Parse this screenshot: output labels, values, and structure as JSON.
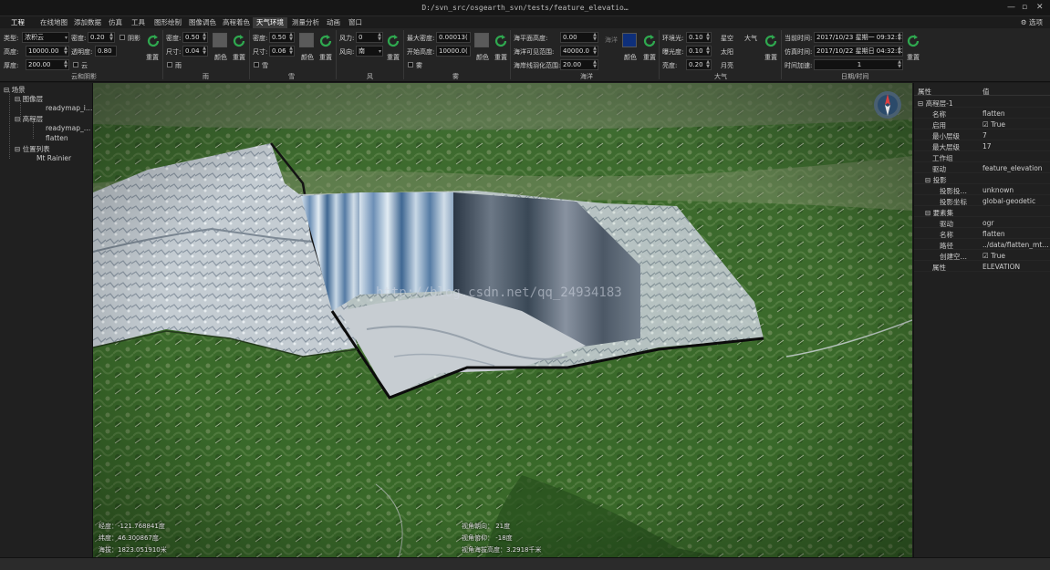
{
  "window": {
    "title": "D:/svn_src/osgearth_svn/tests/feature_elevatio…",
    "options": "选项"
  },
  "menu": [
    "工程",
    "在线地图",
    "添加数据",
    "仿真",
    "工具",
    "图形绘制",
    "图像调色",
    "高程着色",
    "天气环境",
    "测量分析",
    "动画",
    "窗口"
  ],
  "ribbon": {
    "cloud": {
      "type_label": "类型:",
      "type_value": "浓积云",
      "density_label": "密度:",
      "density_value": "0.20",
      "shadow_label": "阴影",
      "height_label": "高度:",
      "height_value": "10000.00",
      "alpha_label": "透明度:",
      "alpha_value": "0.80",
      "thickness_label": "厚度:",
      "thickness_value": "200.00",
      "cloud_check_label": "云",
      "reset_label": "重置",
      "group_label": "云和阴影"
    },
    "rain": {
      "density_label": "密度:",
      "density_value": "0.50",
      "size_label": "尺寸:",
      "size_value": "0.04",
      "enable_label": "雨",
      "color_label": "颜色",
      "reset_label": "重置",
      "group_label": "雨"
    },
    "snow": {
      "density_label": "密度:",
      "density_value": "0.50",
      "size_label": "尺寸:",
      "size_value": "0.06",
      "enable_label": "雪",
      "color_label": "颜色",
      "reset_label": "重置",
      "group_label": "雪"
    },
    "wind": {
      "force_label": "风力:",
      "force_value": "0",
      "dir_label": "风向:",
      "dir_value": "南",
      "reset_label": "重置",
      "group_label": "风"
    },
    "fog": {
      "maxdens_label": "最大密度:",
      "maxdens_value": "0.00013(",
      "start_label": "开始高度:",
      "start_value": "10000.0(",
      "enable_label": "雾",
      "color_label": "颜色",
      "reset_label": "重置",
      "group_label": "雾"
    },
    "ocean": {
      "sealevel_label": "海平面高度:",
      "sealevel_value": "0.00",
      "visible_label": "海洋可见范围:",
      "visible_value": "40000.0",
      "fade_label": "海岸线羽化范围:",
      "fade_value": "20.00",
      "sea_label": "海洋",
      "color_label": "颜色",
      "reset_label": "重置",
      "group_label": "海洋"
    },
    "atmos": {
      "ambient_label": "环境光:",
      "ambient_value": "0.10",
      "exposure_label": "曝光度:",
      "exposure_value": "0.10",
      "brightness_label": "亮度:",
      "brightness_value": "0.20",
      "stars_label": "星空",
      "sun_label": "太阳",
      "moon_label": "月亮",
      "atmosphere_label": "大气",
      "reset_label": "重置",
      "group_label": "大气"
    },
    "time": {
      "current_label": "当前时间:",
      "current_value": "2017/10/23 星期一 09:32:11",
      "sim_label": "仿真时间:",
      "sim_value": "2017/10/22 星期日 04:32:12",
      "speed_label": "时间加速:",
      "speed_value": "1",
      "reset_label": "重置",
      "group_label": "日期/时间"
    }
  },
  "scene_tree": {
    "root": "场景",
    "image_layer": "图像层",
    "image_item": "readymap_i…",
    "elev_layer": "高程层",
    "elev_item1": "readymap_…",
    "elev_item2": "flatten",
    "pos_list": "位置列表",
    "pos_item": "Mt Rainier"
  },
  "viewport": {
    "lon": "经度：-121.768841度",
    "lat": "纬度：46.300867度",
    "alt": "海拔：1823.051910米",
    "heading": "视角朝向：       21度",
    "pitch": "视角俯仰：       -18度",
    "eye_alt": "视角海拔高度：3.2918千米",
    "watermark": "http://blog.csdn.net/qq_24934183"
  },
  "properties": {
    "col_prop": "属性",
    "col_value": "值",
    "rows": [
      {
        "k": "高程层-1",
        "v": "",
        "indent": 0,
        "exp": true
      },
      {
        "k": "名称",
        "v": "flatten",
        "indent": 2
      },
      {
        "k": "启用",
        "v": "True",
        "indent": 2,
        "check": true
      },
      {
        "k": "最小层级",
        "v": "7",
        "indent": 2
      },
      {
        "k": "最大层级",
        "v": "17",
        "indent": 2
      },
      {
        "k": "工作组",
        "v": "",
        "indent": 2
      },
      {
        "k": "驱动",
        "v": "feature_elevation",
        "indent": 2
      },
      {
        "k": "投影",
        "v": "",
        "indent": 1,
        "exp": true
      },
      {
        "k": "投影投…",
        "v": "unknown",
        "indent": 3
      },
      {
        "k": "投影坐标",
        "v": "global-geodetic",
        "indent": 3
      },
      {
        "k": "要素集",
        "v": "",
        "indent": 1,
        "exp": true
      },
      {
        "k": "驱动",
        "v": "ogr",
        "indent": 3
      },
      {
        "k": "名称",
        "v": "flatten",
        "indent": 3
      },
      {
        "k": "路径",
        "v": "../data/flatten_mt…",
        "indent": 3
      },
      {
        "k": "创建空…",
        "v": "True",
        "indent": 3,
        "check": true
      },
      {
        "k": "属性",
        "v": "ELEVATION",
        "indent": 2
      }
    ]
  },
  "colors": {
    "accent": "#2fa84f",
    "ocean_swatch": "#0e2f7a",
    "swatch_gray": "#5a5a5a"
  }
}
